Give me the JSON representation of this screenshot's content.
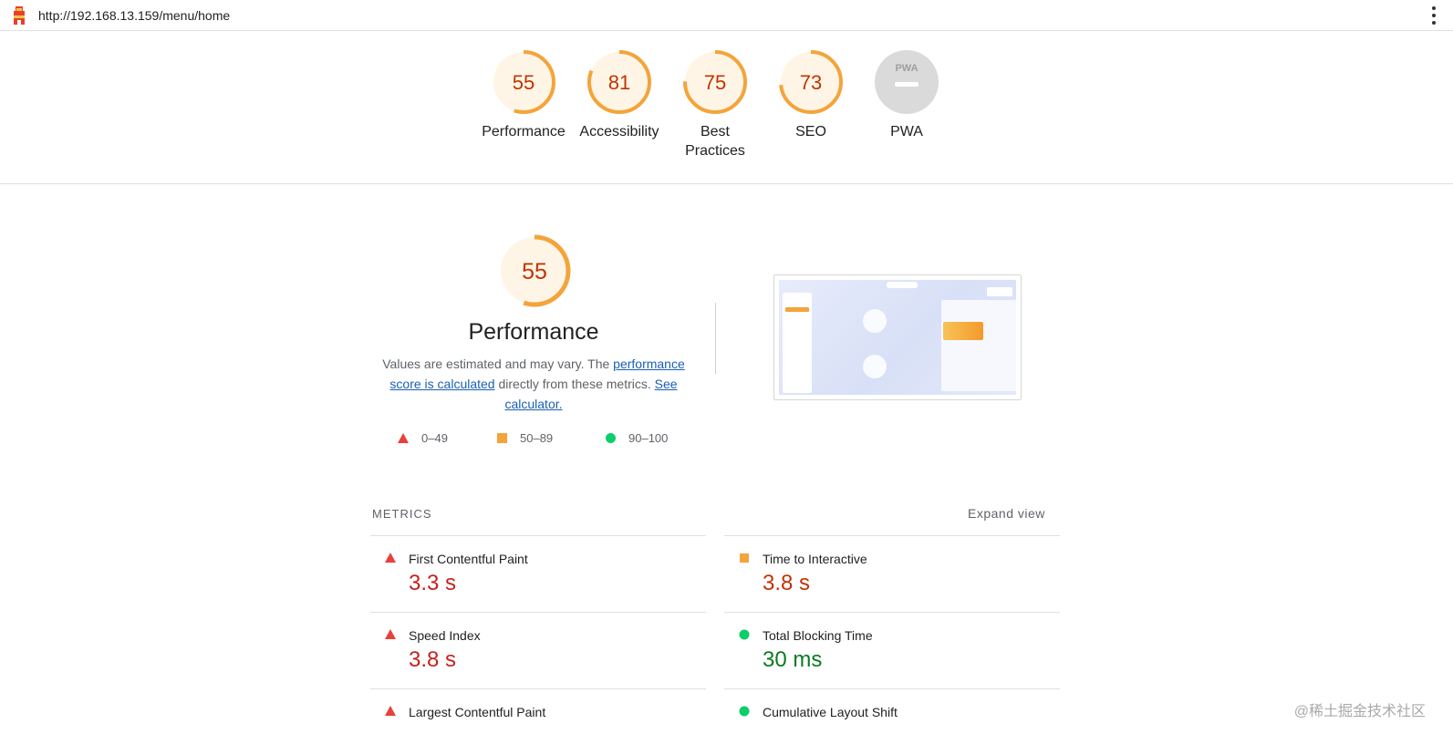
{
  "browser": {
    "url": "http://192.168.13.159/menu/home"
  },
  "colors": {
    "fail": "#e8403b",
    "average": "#f4a43a",
    "pass": "#0cce6b",
    "gauge_bg": "#fff5e6",
    "pwa_gray": "#dadada"
  },
  "categories": [
    {
      "score": "55",
      "label": "Performance"
    },
    {
      "score": "81",
      "label": "Accessibility"
    },
    {
      "score": "75",
      "label": "Best Practices"
    },
    {
      "score": "73",
      "label": "SEO"
    },
    {
      "score": "",
      "label": "PWA",
      "icon": "pwa-icon"
    }
  ],
  "performance": {
    "score": "55",
    "title": "Performance",
    "desc_1": "Values are estimated and may vary. The ",
    "link_1": "performance score is calculated",
    "desc_2": " directly from these metrics. ",
    "link_2": "See calculator."
  },
  "legend": [
    {
      "range": "0–49",
      "icon": "fail-triangle-icon"
    },
    {
      "range": "50–89",
      "icon": "average-square-icon"
    },
    {
      "range": "90–100",
      "icon": "pass-circle-icon"
    }
  ],
  "metrics": {
    "heading": "METRICS",
    "expand_label": "Expand view",
    "items": [
      {
        "name": "First Contentful Paint",
        "value": "3.3 s",
        "rating": "fail"
      },
      {
        "name": "Time to Interactive",
        "value": "3.8 s",
        "rating": "average"
      },
      {
        "name": "Speed Index",
        "value": "3.8 s",
        "rating": "fail"
      },
      {
        "name": "Total Blocking Time",
        "value": "30 ms",
        "rating": "pass"
      },
      {
        "name": "Largest Contentful Paint",
        "value": "",
        "rating": "fail"
      },
      {
        "name": "Cumulative Layout Shift",
        "value": "",
        "rating": "pass"
      }
    ]
  },
  "watermark": "@稀土掘金技术社区"
}
